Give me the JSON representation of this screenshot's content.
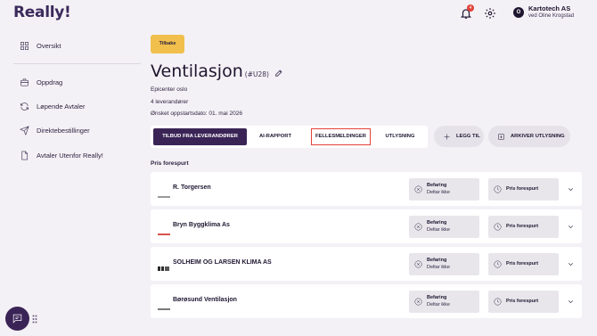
{
  "app": {
    "logo": "Really!",
    "notifications_count": "4",
    "account": {
      "initial": "O",
      "company": "Kartotech AS",
      "subtitle": "ved Oline Krogstad"
    }
  },
  "sidebar": {
    "items": [
      {
        "label": "Oversikt",
        "icon": "grid-icon"
      },
      {
        "label": "Oppdrag",
        "icon": "briefcase-icon"
      },
      {
        "label": "Løpende Avtaler",
        "icon": "refresh-icon"
      },
      {
        "label": "Direktebestillinger",
        "icon": "send-icon"
      },
      {
        "label": "Avtaler Utenfor Really!",
        "icon": "document-icon"
      }
    ]
  },
  "page": {
    "back_label": "Tilbake",
    "title": "Ventilasjon",
    "id": "(#U28)",
    "location": "Epicenter oslo",
    "suppliers": "4 leverandører",
    "start_date": "Ønsket oppstartsdato: 01. mai 2026"
  },
  "tabs": [
    {
      "label": "TILBUD FRA LEVERANDØRER",
      "active": true
    },
    {
      "label": "AI-RAPPORT",
      "active": false
    },
    {
      "label": "FELLESMELDINGER",
      "active": false
    },
    {
      "label": "UTLYSNING",
      "active": false
    }
  ],
  "actions": {
    "add_label": "LEGG TIL",
    "archive_label": "ARKIVER UTLYSNING"
  },
  "section": {
    "label": "Pris forespurt"
  },
  "suppliers": [
    {
      "name": "R. Torgersen",
      "logo_text": "RTGRSN",
      "status1_title": "Befaring",
      "status1_sub": "Deltar ikke",
      "status2": "Pris forespurt",
      "logo_color": "#9a9a9a"
    },
    {
      "name": "Bryn Byggklima As",
      "logo_text": "BRYN",
      "status1_title": "Befaring",
      "status1_sub": "Deltar ikke",
      "status2": "Pris forespurt",
      "logo_color": "#d9534f"
    },
    {
      "name": "SOLHEIM OG LARSEN KLIMA AS",
      "logo_text": "S&K",
      "status1_title": "Befaring",
      "status1_sub": "Deltar ikke",
      "status2": "Pris forespurt",
      "logo_color": "#2a2a2a"
    },
    {
      "name": "Børøsund Ventilasjon",
      "logo_text": "BRSND",
      "status1_title": "Befaring",
      "status1_sub": "Deltar ikke",
      "status2": "Pris forespurt",
      "logo_color": "#7a7a7a"
    }
  ],
  "colors": {
    "accent": "#3a2456",
    "back_button": "#f0bf4c",
    "badge": "#e2413a",
    "background": "#f4f1f6"
  }
}
